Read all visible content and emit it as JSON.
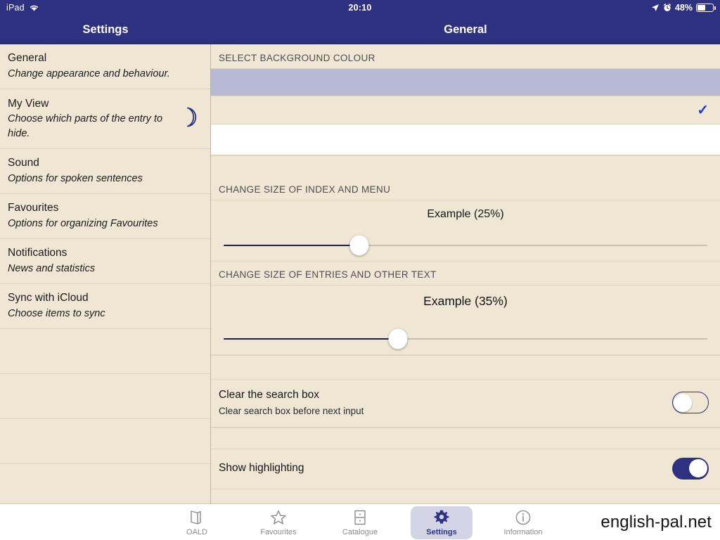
{
  "status_bar": {
    "device": "iPad",
    "wifi_icon": "wifi-icon",
    "time": "20:10",
    "location_icon": "location-arrow-icon",
    "alarm_icon": "alarm-clock-icon",
    "battery_percent": "48%",
    "battery_level": 48
  },
  "nav": {
    "sidebar_title": "Settings",
    "detail_title": "General"
  },
  "sidebar": {
    "items": [
      {
        "title": "General",
        "subtitle": "Change appearance and behaviour.",
        "icon": ""
      },
      {
        "title": "My View",
        "subtitle": "Choose which parts of the entry to hide.",
        "icon": "moon-icon"
      },
      {
        "title": "Sound",
        "subtitle": "Options for spoken sentences",
        "icon": ""
      },
      {
        "title": "Favourites",
        "subtitle": "Options for organizing Favourites",
        "icon": ""
      },
      {
        "title": "Notifications",
        "subtitle": "News and statistics",
        "icon": ""
      },
      {
        "title": "Sync with iCloud",
        "subtitle": "Choose items to sync",
        "icon": ""
      }
    ],
    "empty_row_count": 4
  },
  "main": {
    "background_section": {
      "header": "SELECT BACKGROUND COLOUR",
      "options": [
        {
          "name": "lavender",
          "color": "#b8bad4",
          "selected": false
        },
        {
          "name": "cream",
          "color": "#efe7d3",
          "selected": true
        },
        {
          "name": "white",
          "color": "#ffffff",
          "selected": false
        }
      ],
      "check_icon": "check-icon",
      "check_color": "#1a3bd6"
    },
    "index_size_section": {
      "header": "CHANGE SIZE OF INDEX AND MENU",
      "example_label": "Example (25%)",
      "value": 25,
      "thumb_position_percent": 28
    },
    "entry_size_section": {
      "header": "CHANGE SIZE OF ENTRIES AND OTHER TEXT",
      "example_label": "Example (35%)",
      "value": 35,
      "thumb_position_percent": 36
    },
    "toggles": [
      {
        "title": "Clear the search box",
        "subtitle": "Clear search box before next input",
        "on": false
      },
      {
        "title": "Show highlighting",
        "subtitle": "",
        "on": true
      }
    ]
  },
  "tabbar": {
    "tabs": [
      {
        "label": "OALD",
        "icon": "book-icon",
        "active": false
      },
      {
        "label": "Favourites",
        "icon": "star-icon",
        "active": false
      },
      {
        "label": "Catalogue",
        "icon": "drawer-cabinet-icon",
        "active": false
      },
      {
        "label": "Settings",
        "icon": "gear-icon",
        "active": true
      },
      {
        "label": "Information",
        "icon": "info-circle-icon",
        "active": false
      }
    ],
    "watermark": "english-pal.net"
  },
  "colors": {
    "navy": "#2e3180",
    "cream": "#efe7d3",
    "lavender": "#b8bad4",
    "check_blue": "#1a3bd6",
    "divider": "#ddd5c0"
  }
}
